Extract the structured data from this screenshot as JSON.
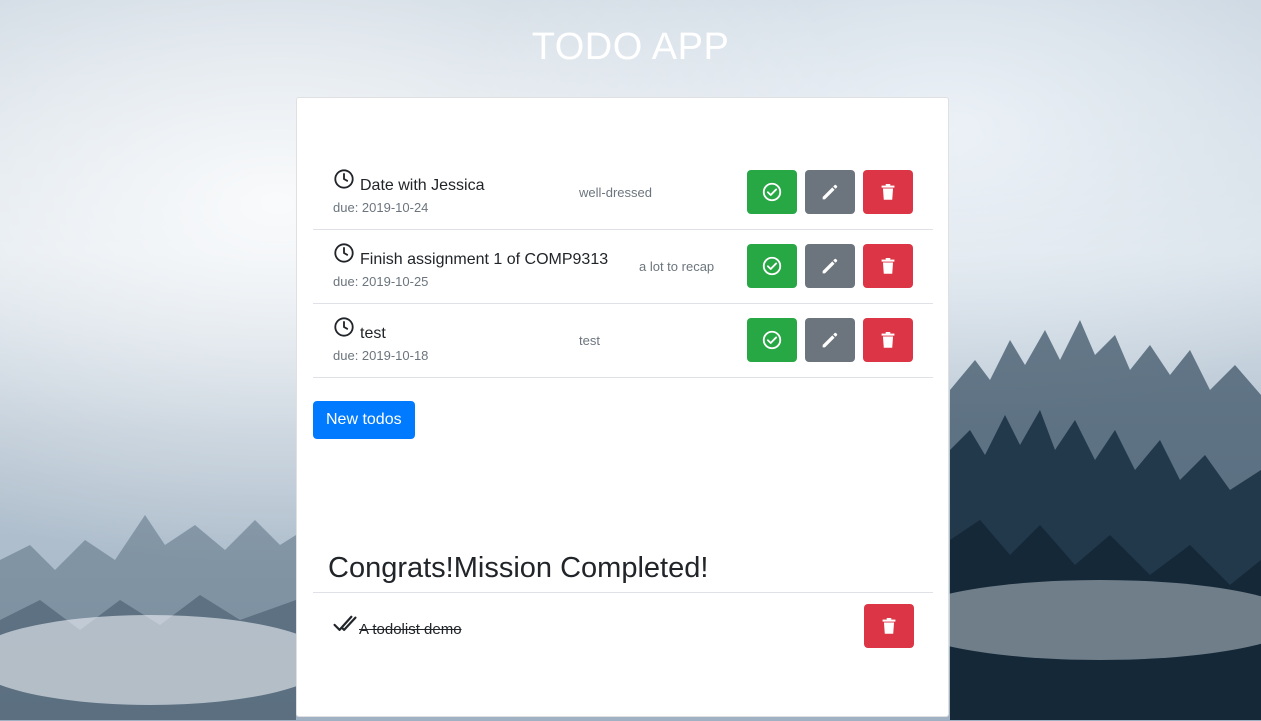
{
  "app": {
    "title": "TODO APP"
  },
  "todos": [
    {
      "name": "Date with Jessica",
      "due": "due: 2019-10-24",
      "note": "well-dressed"
    },
    {
      "name": "Finish assignment 1 of COMP9313",
      "due": "due: 2019-10-25",
      "note": "a lot to recap"
    },
    {
      "name": "test",
      "due": "due: 2019-10-18",
      "note": "test"
    }
  ],
  "actions": {
    "new_todo_label": "New todos"
  },
  "completed": {
    "heading": "Congrats!Mission Completed!",
    "items": [
      {
        "name": "A todolist demo"
      }
    ]
  },
  "icons": {
    "clock": "clock-icon",
    "complete": "check-circle-icon",
    "edit": "pencil-icon",
    "delete": "trash-icon",
    "done": "double-check-icon"
  },
  "colors": {
    "complete": "#28a745",
    "edit": "#6c757d",
    "delete": "#dc3545",
    "primary": "#007bff"
  }
}
